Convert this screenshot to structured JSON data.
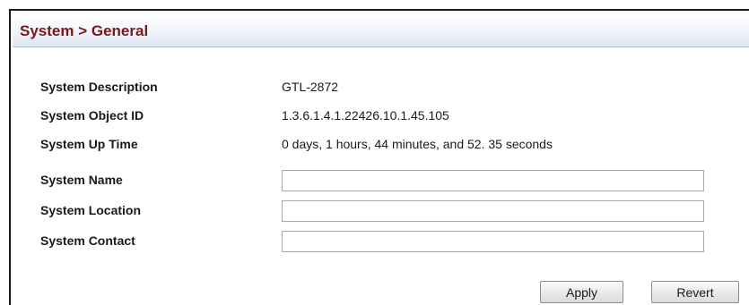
{
  "header": {
    "title": "System > General"
  },
  "info_rows": [
    {
      "label": "System Description",
      "value": "GTL-2872"
    },
    {
      "label": "System Object ID",
      "value": "1.3.6.1.4.1.22426.10.1.45.105"
    },
    {
      "label": "System Up Time",
      "value": "0 days, 1 hours, 44 minutes, and 52. 35 seconds"
    }
  ],
  "fields": [
    {
      "label": "System Name",
      "value": ""
    },
    {
      "label": "System Location",
      "value": ""
    },
    {
      "label": "System Contact",
      "value": ""
    }
  ],
  "buttons": {
    "apply": "Apply",
    "revert": "Revert"
  },
  "colors": {
    "title": "#7a1717",
    "header_gradient_bottom": "#dfe6f0"
  }
}
